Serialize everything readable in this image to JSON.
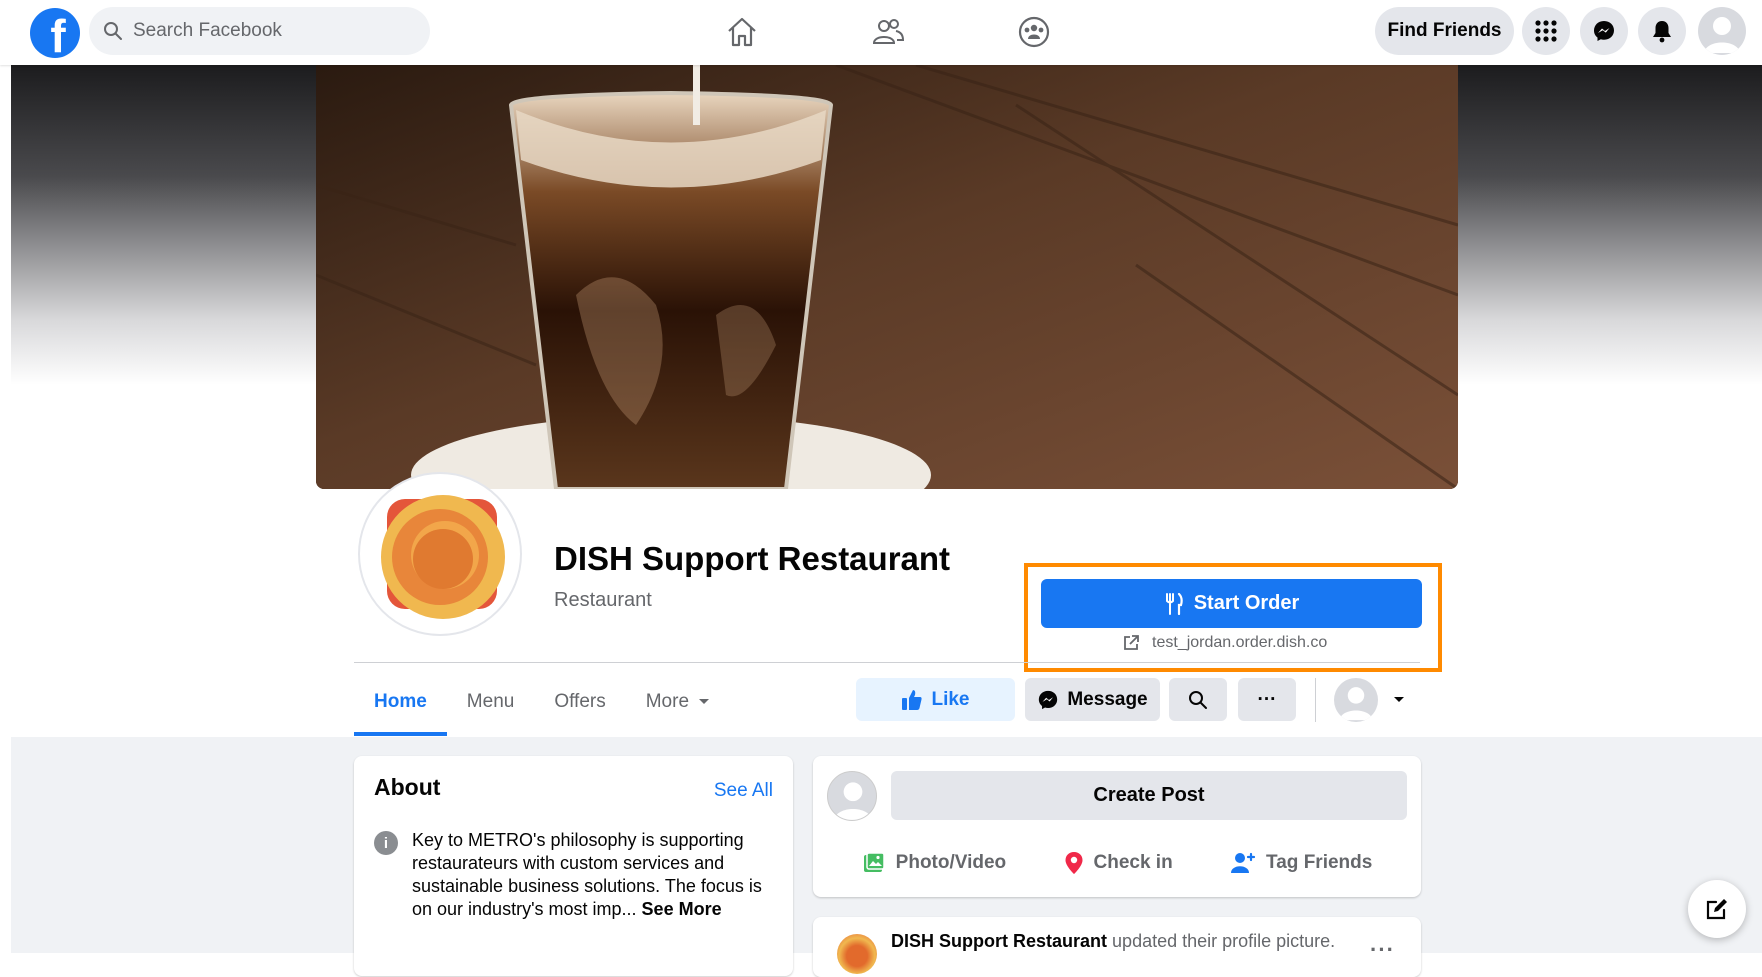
{
  "topbar": {
    "logo": "f",
    "search_placeholder": "Search Facebook",
    "nav_icons": [
      "home-icon",
      "friends-icon",
      "groups-icon"
    ],
    "find_friends": "Find Friends",
    "right_icons": [
      "menu-grid-icon",
      "messenger-icon",
      "notifications-icon"
    ]
  },
  "profile": {
    "name": "DISH Support Restaurant",
    "category": "Restaurant"
  },
  "order": {
    "button_label": "Start Order",
    "link": "test_jordan.order.dish.co",
    "highlight_color": "#ff8a00"
  },
  "tabs": [
    "Home",
    "Menu",
    "Offers",
    "More"
  ],
  "actions": {
    "like": "Like",
    "message": "Message",
    "more": "···"
  },
  "about": {
    "title": "About",
    "see_all": "See All",
    "text": "Key to METRO's philosophy is supporting restaurateurs with custom services and sustainable business solutions. The focus is on our industry's most imp...",
    "see_more": "See More"
  },
  "create_post": {
    "label": "Create Post",
    "actions": [
      "Photo/Video",
      "Check in",
      "Tag Friends"
    ]
  },
  "post": {
    "author": "DISH Support Restaurant",
    "action": "updated their profile picture.",
    "menu": "···"
  },
  "colors": {
    "brand": "#1877f2",
    "photo_green": "#45bd62",
    "checkin_red": "#f02849"
  }
}
